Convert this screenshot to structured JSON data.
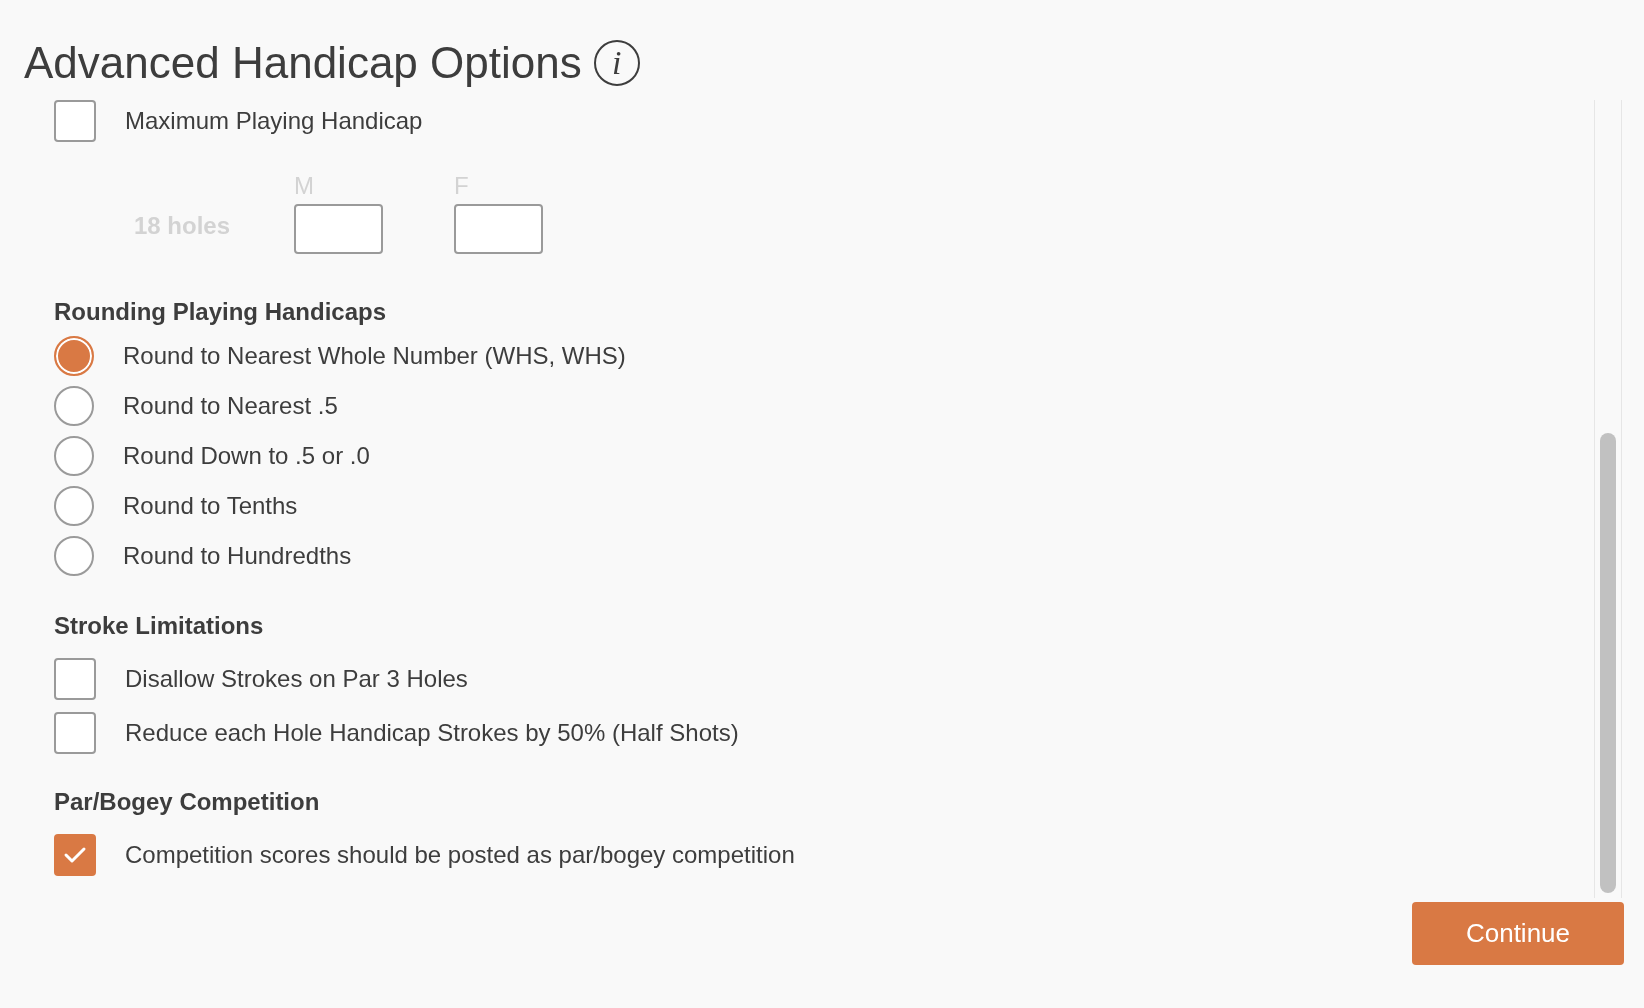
{
  "title": "Advanced Handicap Options",
  "info_icon": "i",
  "max_handicap": {
    "label": "Maximum Playing Handicap",
    "checked": false,
    "row_label": "18 holes",
    "fields": [
      {
        "label": "M"
      },
      {
        "label": "F"
      }
    ]
  },
  "rounding": {
    "heading": "Rounding Playing Handicaps",
    "options": [
      {
        "label": "Round to Nearest Whole Number (WHS, WHS)",
        "selected": true
      },
      {
        "label": "Round to Nearest .5",
        "selected": false
      },
      {
        "label": "Round Down to .5 or .0",
        "selected": false
      },
      {
        "label": "Round to Tenths",
        "selected": false
      },
      {
        "label": "Round to Hundredths",
        "selected": false
      }
    ]
  },
  "stroke_limitations": {
    "heading": "Stroke Limitations",
    "options": [
      {
        "label": "Disallow Strokes on Par 3 Holes",
        "checked": false
      },
      {
        "label": "Reduce each Hole Handicap Strokes by 50% (Half Shots)",
        "checked": false
      }
    ]
  },
  "par_bogey": {
    "heading": "Par/Bogey Competition",
    "options": [
      {
        "label": "Competition scores should be posted as par/bogey competition",
        "checked": true
      }
    ]
  },
  "continue_button": "Continue"
}
